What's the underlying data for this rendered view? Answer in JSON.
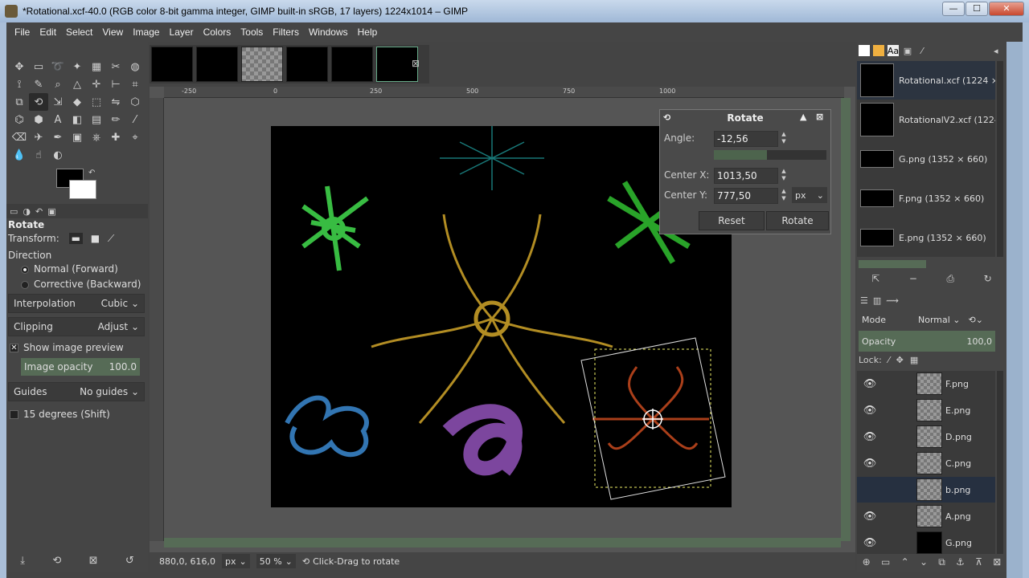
{
  "window": {
    "title": "*Rotational.xcf-40.0 (RGB color 8-bit gamma integer, GIMP built-in sRGB, 17 layers) 1224x1014 – GIMP",
    "min": "—",
    "max": "☐",
    "close": "✕"
  },
  "menu": [
    "File",
    "Edit",
    "Select",
    "View",
    "Image",
    "Layer",
    "Colors",
    "Tools",
    "Filters",
    "Windows",
    "Help"
  ],
  "tool_options": {
    "title": "Rotate",
    "transform_label": "Transform:",
    "direction_label": "Direction",
    "direction_normal": "Normal (Forward)",
    "direction_corrective": "Corrective (Backward)",
    "interpolation_label": "Interpolation",
    "interpolation_value": "Cubic",
    "clipping_label": "Clipping",
    "clipping_value": "Adjust",
    "show_preview": "Show image preview",
    "image_opacity_label": "Image opacity",
    "image_opacity_value": "100.0",
    "guides_label": "Guides",
    "guides_value": "No guides",
    "degrees_label": "15 degrees (Shift)"
  },
  "ruler": {
    "h": [
      "-250",
      "0",
      "250",
      "500",
      "750",
      "1000"
    ]
  },
  "rotate_dialog": {
    "title": "Rotate",
    "angle_label": "Angle:",
    "angle_value": "-12,56",
    "angle_slider_fraction": 0.47,
    "center_x_label": "Center X:",
    "center_x_value": "1013,50",
    "center_y_label": "Center Y:",
    "center_y_value": "777,50",
    "unit": "px",
    "reset": "Reset",
    "rotate": "Rotate"
  },
  "status": {
    "coords": "880,0, 616,0",
    "unit": "px",
    "zoom": "50 %",
    "message": "Click-Drag to rotate"
  },
  "images": [
    {
      "name": "Rotational.xcf (1224 ×",
      "selected": true
    },
    {
      "name": "RotationalV2.xcf (1224",
      "selected": false
    },
    {
      "name": "G.png (1352 × 660)",
      "selected": false
    },
    {
      "name": "F.png (1352 × 660)",
      "selected": false
    },
    {
      "name": "E.png (1352 × 660)",
      "selected": false
    }
  ],
  "layers_panel": {
    "mode_label": "Mode",
    "mode_value": "Normal",
    "opacity_label": "Opacity",
    "opacity_value": "100,0",
    "lock_label": "Lock:",
    "layers": [
      {
        "name": "F.png",
        "visible": true
      },
      {
        "name": "E.png",
        "visible": true
      },
      {
        "name": "D.png",
        "visible": true
      },
      {
        "name": "C.png",
        "visible": true
      },
      {
        "name": "b.png",
        "visible": false,
        "selected": true
      },
      {
        "name": "A.png",
        "visible": true
      },
      {
        "name": "G.png",
        "visible": true
      }
    ]
  }
}
